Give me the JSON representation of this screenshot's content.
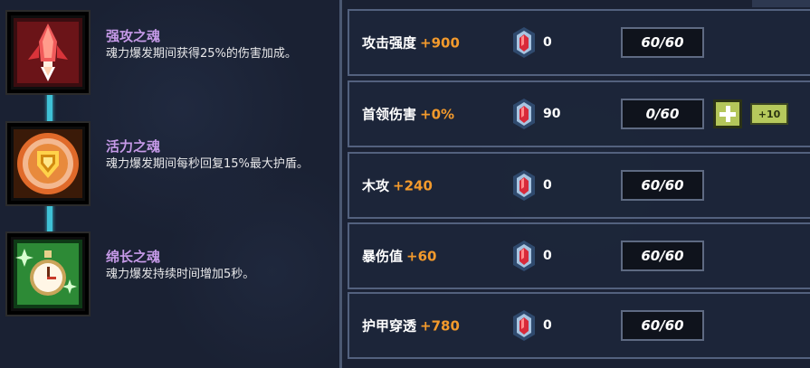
{
  "skills": [
    {
      "title": "强攻之魂",
      "desc": "魂力爆发期间获得25%的伤害加成。",
      "icon": "red-rocket-icon"
    },
    {
      "title": "活力之魂",
      "desc": "魂力爆发期间每秒回复15%最大护盾。",
      "icon": "shield-medallion-icon"
    },
    {
      "title": "绵长之魂",
      "desc": "魂力爆发持续时间增加5秒。",
      "icon": "stopwatch-icon"
    }
  ],
  "stats": [
    {
      "label": "攻击强度",
      "bonus": "+900",
      "gems": "0",
      "level": "60/60",
      "upgradable": false
    },
    {
      "label": "首领伤害",
      "bonus": "+0%",
      "gems": "90",
      "level": "0/60",
      "upgradable": true,
      "plus10": "+10"
    },
    {
      "label": "木攻",
      "bonus": "+240",
      "gems": "0",
      "level": "60/60",
      "upgradable": false
    },
    {
      "label": "暴伤值",
      "bonus": "+60",
      "gems": "0",
      "level": "60/60",
      "upgradable": false
    },
    {
      "label": "护甲穿透",
      "bonus": "+780",
      "gems": "0",
      "level": "60/60",
      "upgradable": false
    }
  ],
  "colors": {
    "bonus": "#f39a2c",
    "skill_title": "#c69ae8",
    "connector": "#3fc1d6",
    "upgrade_button": "#b4c65a"
  }
}
